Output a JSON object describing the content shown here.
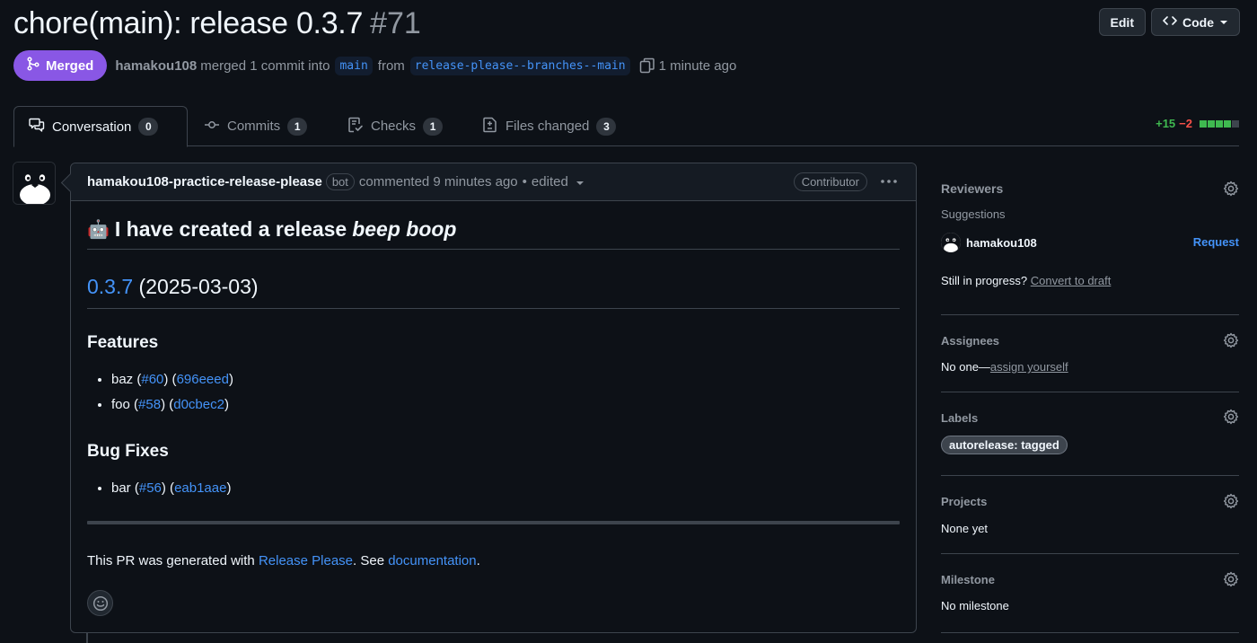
{
  "header": {
    "title": "chore(main): release 0.3.7",
    "number": "#71",
    "edit_label": "Edit",
    "code_label": "Code"
  },
  "meta": {
    "status": "Merged",
    "author": "hamakou108",
    "text_merged": "merged 1 commit into",
    "base_branch": "main",
    "text_from": "from",
    "head_branch": "release-please--branches--main",
    "time": "1 minute ago"
  },
  "tabs": [
    {
      "label": "Conversation",
      "count": "0"
    },
    {
      "label": "Commits",
      "count": "1"
    },
    {
      "label": "Checks",
      "count": "1"
    },
    {
      "label": "Files changed",
      "count": "3"
    }
  ],
  "diffstat": {
    "additions": "+15",
    "deletions": "−2"
  },
  "colors": {
    "merged": "#8957e5",
    "link": "#4493f8",
    "add": "#3fb950",
    "del": "#f85149"
  },
  "comment": {
    "author": "hamakou108-practice-release-please",
    "bot_label": "bot",
    "time_text": "commented 9 minutes ago",
    "separator": "•",
    "edited": "edited",
    "role": "Contributor",
    "heading_emoji": "🤖",
    "heading_text": "I have created a release",
    "heading_emph": "beep boop",
    "version": "0.3.7",
    "date": "(2025-03-03)",
    "features_title": "Features",
    "features": [
      {
        "name": "baz",
        "pr": "#60",
        "sha": "696eeed"
      },
      {
        "name": "foo",
        "pr": "#58",
        "sha": "d0cbec2"
      }
    ],
    "bugfix_title": "Bug Fixes",
    "bugfixes": [
      {
        "name": "bar",
        "pr": "#56",
        "sha": "eab1aae"
      }
    ],
    "footer_prefix": "This PR was generated with",
    "footer_link1": "Release Please",
    "footer_mid": ". See",
    "footer_link2": "documentation",
    "footer_suffix": "."
  },
  "sidebar": {
    "reviewers_title": "Reviewers",
    "suggestions": "Suggestions",
    "suggested_reviewer": "hamakou108",
    "request_label": "Request",
    "draft_prefix": "Still in progress?",
    "draft_link": "Convert to draft",
    "assignees_title": "Assignees",
    "assignees_prefix": "No one—",
    "assignees_link": "assign yourself",
    "labels_title": "Labels",
    "label": "autorelease: tagged",
    "projects_title": "Projects",
    "projects_value": "None yet",
    "milestone_title": "Milestone",
    "milestone_value": "No milestone"
  }
}
